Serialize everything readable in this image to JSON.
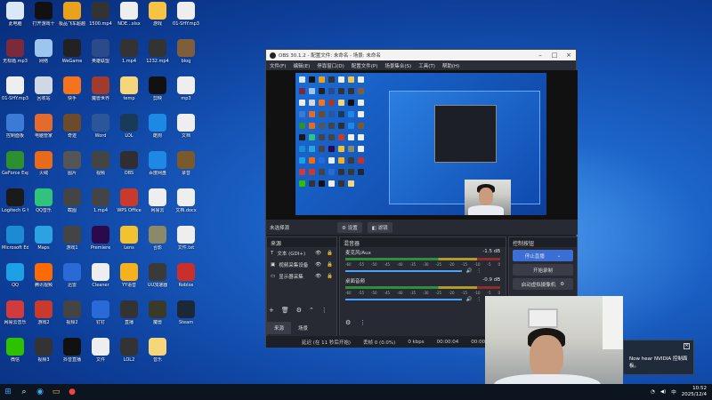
{
  "desktop_icons": [
    {
      "label": "此电脑",
      "color": "#d9e9f7"
    },
    {
      "label": "打开游戏十",
      "color": "#111"
    },
    {
      "label": "极品飞车超越极限",
      "color": "#e9a21a"
    },
    {
      "label": "1500.mp4",
      "color": "#333"
    },
    {
      "label": "NDE...xlsx",
      "color": "#eee"
    },
    {
      "label": "游戏",
      "color": "#f6c343"
    },
    {
      "label": "01-SHY.mp3",
      "color": "#eee"
    },
    {
      "label": "无标题.mp3",
      "color": "#7a2a3a"
    },
    {
      "label": "网络",
      "color": "#9cc6ef"
    },
    {
      "label": "WeGame",
      "color": "#222"
    },
    {
      "label": "英雄联盟",
      "color": "#2b4a8a"
    },
    {
      "label": "1.mp4",
      "color": "#333"
    },
    {
      "label": "1232.mp4",
      "color": "#333"
    },
    {
      "label": "blog",
      "color": "#7e5e3b"
    },
    {
      "label": "01-SHY.mp3",
      "color": "#eee"
    },
    {
      "label": "回收站",
      "color": "#cfd8e3"
    },
    {
      "label": "快手",
      "color": "#f5731c"
    },
    {
      "label": "魔兽世界",
      "color": "#a13b2e"
    },
    {
      "label": "temp",
      "color": "#f6d67a"
    },
    {
      "label": "剪映",
      "color": "#111"
    },
    {
      "label": "mp3",
      "color": "#eee"
    },
    {
      "label": "控制面板",
      "color": "#3b7bd6"
    },
    {
      "label": "电脑管家",
      "color": "#e46b2b"
    },
    {
      "label": "奇迹",
      "color": "#6d4a2a"
    },
    {
      "label": "Word",
      "color": "#2b579a"
    },
    {
      "label": "LOL",
      "color": "#1a3a5a"
    },
    {
      "label": "酷狗",
      "color": "#1e88e5"
    },
    {
      "label": "文档",
      "color": "#eee"
    },
    {
      "label": "GeForce Experience",
      "color": "#2d8f2d"
    },
    {
      "label": "火绒",
      "color": "#e86a1a"
    },
    {
      "label": "图片",
      "color": "#555"
    },
    {
      "label": "视频",
      "color": "#444"
    },
    {
      "label": "OBS",
      "color": "#302e31"
    },
    {
      "label": "百度网盘",
      "color": "#1e88e5"
    },
    {
      "label": "录音",
      "color": "#7a5a2a"
    },
    {
      "label": "Logitech G HUB",
      "color": "#1a1a1a"
    },
    {
      "label": "QQ音乐",
      "color": "#31c27c"
    },
    {
      "label": "截图",
      "color": "#444"
    },
    {
      "label": "1.mp4",
      "color": "#444"
    },
    {
      "label": "WPS Office",
      "color": "#c93a2b"
    },
    {
      "label": "网易云",
      "color": "#eee"
    },
    {
      "label": "文档.docx",
      "color": "#eee"
    },
    {
      "label": "Microsoft Edge",
      "color": "#1b8bd3"
    },
    {
      "label": "Maps",
      "color": "#2aa3e0"
    },
    {
      "label": "游戏1",
      "color": "#444"
    },
    {
      "label": "Premiere",
      "color": "#2a0a4a"
    },
    {
      "label": "Lens",
      "color": "#f2c230"
    },
    {
      "label": "合影",
      "color": "#8a8a6a"
    },
    {
      "label": "文件.txt",
      "color": "#eee"
    },
    {
      "label": "QQ",
      "color": "#1ea0e6"
    },
    {
      "label": "腾讯视频",
      "color": "#ff6a00"
    },
    {
      "label": "迅雷",
      "color": "#2a6ad6"
    },
    {
      "label": "Cleaner",
      "color": "#eee"
    },
    {
      "label": "YY语音",
      "color": "#f5b21c"
    },
    {
      "label": "UU加速器",
      "color": "#3a3a3a"
    },
    {
      "label": "Roblox",
      "color": "#c9302c"
    },
    {
      "label": "网易云音乐",
      "color": "#d13b3b"
    },
    {
      "label": "游戏2",
      "color": "#c93a2b"
    },
    {
      "label": "视频2",
      "color": "#444"
    },
    {
      "label": "钉钉",
      "color": "#2a6ad6"
    },
    {
      "label": "直播",
      "color": "#333"
    },
    {
      "label": "魔兽",
      "color": "#3a3a2a"
    },
    {
      "label": "Steam",
      "color": "#1b2838"
    },
    {
      "label": "微信",
      "color": "#2dc100"
    },
    {
      "label": "视频3",
      "color": "#333"
    },
    {
      "label": "抖音直播",
      "color": "#111"
    },
    {
      "label": "文件",
      "color": "#eee"
    },
    {
      "label": "LOL2",
      "color": "#333"
    },
    {
      "label": "音乐",
      "color": "#f6d67a"
    }
  ],
  "obs": {
    "title": "OBS 30.1.2 - 配置文件: 未命名 - 场景: 未命名",
    "menu": [
      "文件(F)",
      "编辑(E)",
      "停靠窗口(D)",
      "配置文件(P)",
      "场景集合(S)",
      "工具(T)",
      "帮助(H)"
    ],
    "no_source": "未选择源",
    "settings_btn": "⚙ 设置",
    "filters_btn": "◧ 滤镜",
    "sources_title": "来源",
    "sources": [
      {
        "icon": "T",
        "label": "文本 (GDI+)"
      },
      {
        "icon": "▣",
        "label": "视频采集设备"
      },
      {
        "icon": "▭",
        "label": "显示器采集"
      }
    ],
    "mixer_title": "混音器",
    "mixer": [
      {
        "name": "麦克风/Aux",
        "db": "-1.5 dB"
      },
      {
        "name": "桌面音频",
        "db": "-0.9 dB"
      }
    ],
    "ticks": [
      "-60",
      "-55",
      "-50",
      "-45",
      "-40",
      "-35",
      "-30",
      "-25",
      "-20",
      "-15",
      "-10",
      "-5",
      "0"
    ],
    "controls_title": "控制按钮",
    "stop_stream": "停止直播",
    "start_record": "开始录制",
    "virtual_cam": "启动虚拟摄像机",
    "scenes_tab": "来源",
    "scene_tab2": "场景",
    "status": {
      "delay": "延迟 (在 11 秒后开始)",
      "dropped": "丢帧 0 (0.0%)",
      "kbps": "0 kbps",
      "time": "00:00:04",
      "rec": "00:00:00"
    }
  },
  "toast": {
    "text": "Now hear NVIDIA 控制面板。"
  },
  "taskbar": {
    "time": "10:52",
    "date": "2025/12/4",
    "lang": "中"
  },
  "colors": {
    "obs_bg": "#1d1f26",
    "accent": "#3b6fd6",
    "desktop": "#1a5fc4"
  }
}
